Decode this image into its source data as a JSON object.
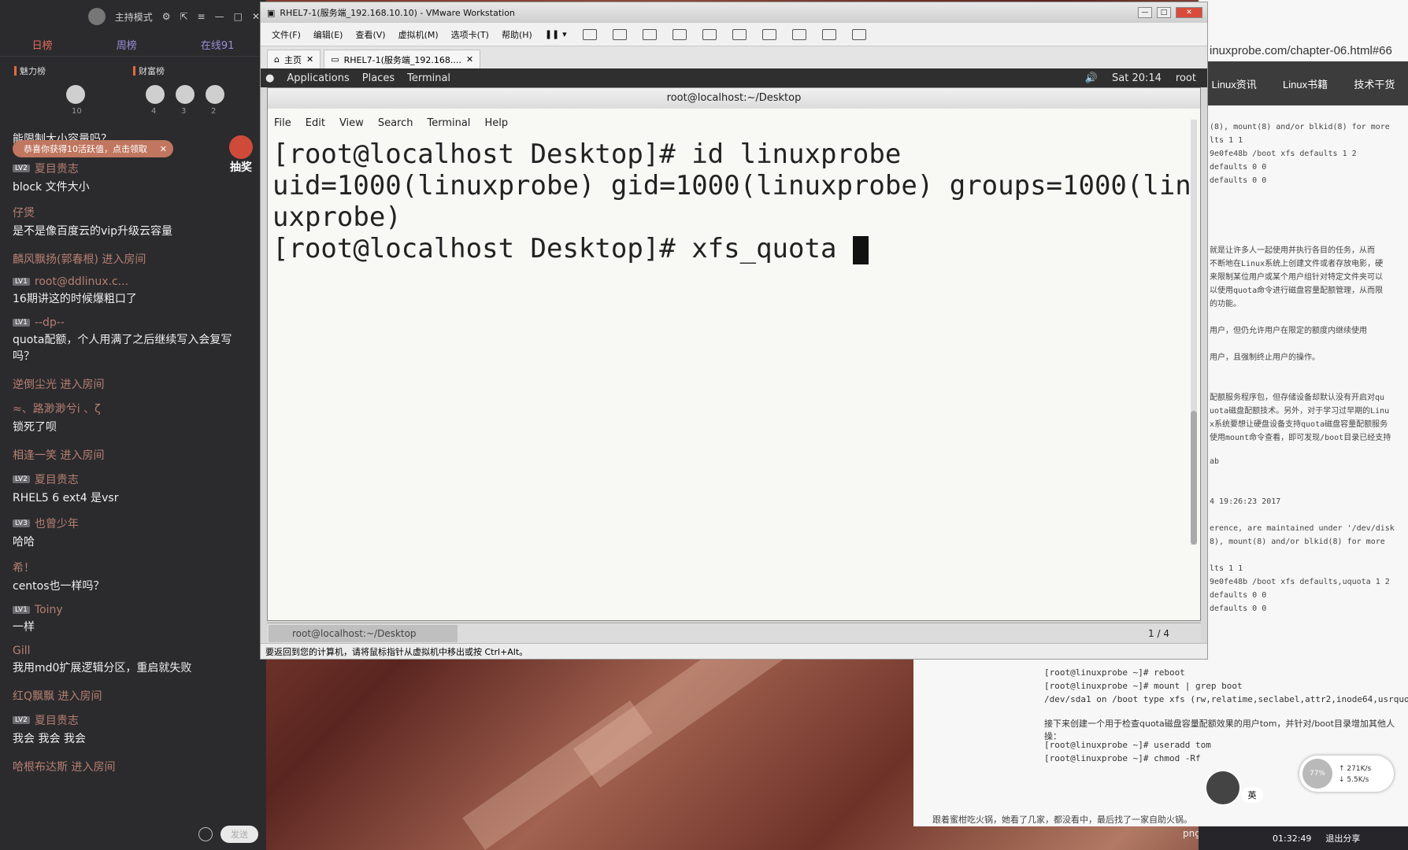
{
  "chat": {
    "top": {
      "mode": "主持模式"
    },
    "tabs": [
      {
        "label": "日榜"
      },
      {
        "label": "周榜"
      },
      {
        "label": "在线91"
      }
    ],
    "rank": {
      "charm": "魅力榜",
      "wealth": "财富榜",
      "charm_count": "10",
      "wealth_counts": [
        "4",
        "3",
        "2"
      ]
    },
    "toast": "恭喜你获得10活跃值，点击领取",
    "lottery": "抽奖",
    "partial_top": "能限制大小容量吗？",
    "messages": [
      {
        "lv": "LV2",
        "name": "夏目贵志",
        "text": "block 文件大小"
      },
      {
        "lv": "",
        "name": "仔煲",
        "text": "是不是像百度云的vip升级云容量"
      },
      {
        "enter": "麟风飘扬(郭春根) 进入房间"
      },
      {
        "lv": "LV1",
        "name": "root@ddlinux.c...",
        "text": "16期讲这的时候爆粗口了"
      },
      {
        "lv": "LV1",
        "name": "--dp--",
        "text": "quota配额，个人用满了之后继续写入会复写吗？"
      },
      {
        "enter": "逆倒尘光 进入房间"
      },
      {
        "lv": "",
        "name": "≈、路渺渺兮i 、ζ",
        "text": "锁死了呗"
      },
      {
        "enter": "相逢一笑 进入房间"
      },
      {
        "lv": "LV2",
        "name": "夏目贵志",
        "text": "RHEL5 6 ext4 是vsr"
      },
      {
        "lv": "LV3",
        "name": "也曾少年",
        "text": "哈哈"
      },
      {
        "lv": "",
        "name": "希！",
        "text": "centos也一样吗？"
      },
      {
        "lv": "LV1",
        "name": "Toiny",
        "text": "一样"
      },
      {
        "lv": "",
        "name": "Gill",
        "text": "我用md0扩展逻辑分区，重启就失败"
      },
      {
        "enter": "红Q飘飘 进入房间"
      },
      {
        "lv": "LV2",
        "name": "夏目贵志",
        "text": "我会 我会 我会"
      },
      {
        "enter": "哈根布达斯 进入房间"
      }
    ],
    "send": "发送"
  },
  "vm": {
    "title": "RHEL7-1(服务端_192.168.10.10) - VMware Workstation",
    "menu": [
      {
        "label": "文件(F)"
      },
      {
        "label": "编辑(E)"
      },
      {
        "label": "查看(V)"
      },
      {
        "label": "虚拟机(M)"
      },
      {
        "label": "选项卡(T)"
      },
      {
        "label": "帮助(H)"
      }
    ],
    "tabs": [
      {
        "label": "主页"
      },
      {
        "label": "RHEL7-1(服务端_192.168...."
      }
    ],
    "gnome": {
      "applications": "Applications",
      "places": "Places",
      "terminal": "Terminal",
      "time": "Sat 20:14",
      "user": "root"
    },
    "status": "要返回到您的计算机，请将鼠标指针从虚拟机中移出或按 Ctrl+Alt。"
  },
  "terminal": {
    "title": "root@localhost:~/Desktop",
    "menu": [
      {
        "label": "File"
      },
      {
        "label": "Edit"
      },
      {
        "label": "View"
      },
      {
        "label": "Search"
      },
      {
        "label": "Terminal"
      },
      {
        "label": "Help"
      }
    ],
    "lines": [
      "[root@localhost Desktop]# id linuxprobe",
      "uid=1000(linuxprobe) gid=1000(linuxprobe) groups=1000(lin",
      "uxprobe)",
      "[root@localhost Desktop]# xfs_quota "
    ],
    "taskbar": "root@localhost:~/Desktop",
    "page": "1 / 4"
  },
  "browser": {
    "url": "inuxprobe.com/chapter-06.html#66",
    "nav": [
      {
        "label": "Linux资讯"
      },
      {
        "label": "Linux书籍"
      },
      {
        "label": "技术干货"
      }
    ],
    "lines": [
      "(8), mount(8) and/or blkid(8) for more",
      "lts 1 1",
      "9e0fe48b /boot xfs defaults 1 2",
      "defaults 0 0",
      "defaults 0 0",
      "",
      "",
      "",
      "",
      "就是让许多人一起使用并执行各目的任务，从而",
      "不断地在Linux系统上创建文件或者存放电影，硬",
      "来限制某位用户或某个用户组针对特定文件夹可以",
      "以使用quota命令进行磁盘容量配额管理，从而限",
      "的功能。",
      "",
      "用户，但仍允许用户在限定的额度内继续使用",
      "",
      "用户，且强制终止用户的操作。",
      "",
      "",
      "配额服务程序包，但存储设备却默认没有开启对qu",
      "uota磁盘配额技术。另外，对于学习过早期的Linu",
      "x系统要想让硬盘设备支持quota磁盘容量配额服务",
      "使用mount命令查看，即可发现/boot目录已经支持",
      "",
      "ab",
      "",
      "",
      "4 19:26:23 2017",
      "",
      "erence, are maintained under '/dev/disk",
      "8), mount(8) and/or blkid(8) for more",
      "",
      "lts 1 1",
      "9e0fe48b /boot xfs defaults,uquota 1 2",
      "defaults 0 0",
      "defaults 0 0"
    ],
    "bottom": [
      "[root@linuxprobe ~]# reboot",
      "[root@linuxprobe ~]# mount | grep boot",
      "/dev/sda1 on /boot type xfs (rw,relatime,seclabel,attr2,inode64,usrquot"
    ],
    "bottom_cn": "接下来创建一个用于检查quota磁盘容量配额效果的用户tom，并针对/boot目录增加其他人",
    "bottom_cn2": "操：",
    "bottom2": [
      "[root@linuxprobe ~]# useradd tom",
      "[root@linuxprobe ~]# chmod -Rf"
    ],
    "speed": {
      "pct": "77%",
      "up": "271K/s",
      "down": "5.5K/s"
    },
    "tip": "跟着蜜柑吃火锅，她看了几家，都没看中，最后找了一家自助火锅。",
    "ime": "英",
    "clock": "01:32:49",
    "exit": "退出分享",
    "png": "png"
  }
}
